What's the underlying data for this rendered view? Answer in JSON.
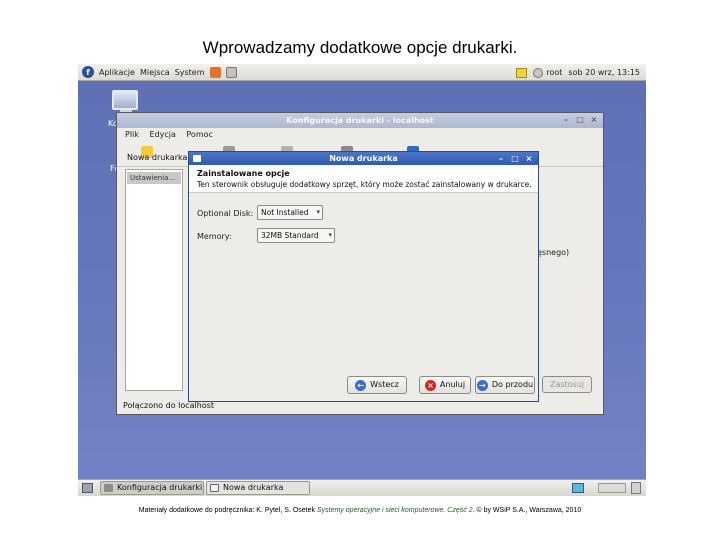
{
  "slide": {
    "title": "Wprowadzamy dodatkowe opcje drukarki.",
    "footer_prefix": "Materiały dodatkowe do podręcznika: K. Pytel, S. Osetek",
    "footer_book": "Systemy operacyjne i sieci komputerowe. Część 2",
    "footer_suffix": ". © by WSiP S.A., Warszawa, 2010"
  },
  "top_panel": {
    "logo": "f",
    "menus": [
      "Aplikacje",
      "Miejsca",
      "System"
    ],
    "icons": [
      "firefox-icon",
      "mail-icon"
    ],
    "user": "root",
    "datetime": "sob 20 wrz, 13:15"
  },
  "desktop": {
    "computer_label": "Kom",
    "folder_label": "Folder"
  },
  "main_window": {
    "title": "Konfiguracja drukarki - localhost",
    "menus": [
      "Plik",
      "Edycja",
      "Pomoc"
    ],
    "toolbar_label": "Nowa drukarka",
    "side_item": "Ustawienia...",
    "partial_text": "ęsnego)",
    "apply_button": "Zastosuj",
    "status": "Połączono do localhost"
  },
  "dialog": {
    "title": "Nowa drukarka",
    "heading": "Zainstalowane opcje",
    "description": "Ten sterownik obsługuje dodatkowy sprzęt, który może zostać zainstalowany w drukarce.",
    "optional_disk_label": "Optional Disk:",
    "optional_disk_value": "Not Installed",
    "memory_label": "Memory:",
    "memory_value": "32MB Standard",
    "back_button": "Wstecz",
    "cancel_button": "Anuluj",
    "forward_button": "Do przodu"
  },
  "taskbar": {
    "tasks": [
      "Konfiguracja drukarki...",
      "Nowa drukarka"
    ]
  },
  "colors": {
    "desktop": "#6676bd",
    "dialog_title": "#2f5bb3",
    "panel": "#e7e5e0"
  }
}
